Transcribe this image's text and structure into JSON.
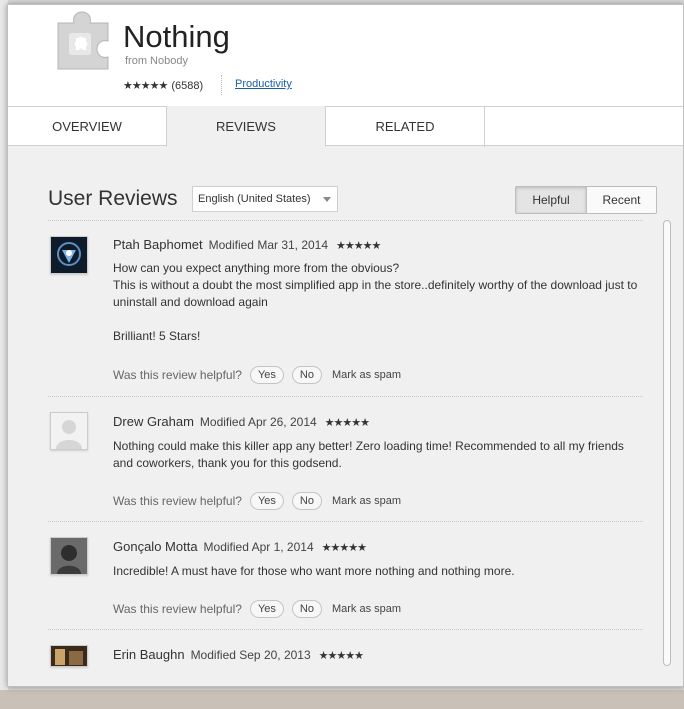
{
  "app": {
    "title": "Nothing",
    "author": "from Nobody",
    "stars": "★★★★★",
    "rating_count": "(6588)",
    "category": "Productivity"
  },
  "tabs": [
    {
      "label": "OVERVIEW",
      "active": false
    },
    {
      "label": "REVIEWS",
      "active": true
    },
    {
      "label": "RELATED",
      "active": false
    }
  ],
  "reviews_section": {
    "title": "User Reviews",
    "language": "English (United States)",
    "sort_helpful": "Helpful",
    "sort_recent": "Recent"
  },
  "reviews": [
    {
      "name": "Ptah Baphomet",
      "date": "Modified Mar 31, 2014",
      "stars": "★★★★★",
      "text": [
        "How can you expect anything more from the obvious?",
        "This is without a doubt the most simplified app in the store..definitely worthy of the download just to uninstall and download again",
        "",
        "Brilliant! 5 Stars!"
      ],
      "helpful_prompt": "Was this review helpful?",
      "yes": "Yes",
      "no": "No",
      "spam": "Mark as spam"
    },
    {
      "name": "Drew Graham",
      "date": "Modified Apr 26, 2014",
      "stars": "★★★★★",
      "text": [
        "Nothing could make this killer app any better! Zero loading time! Recommended to all my friends and coworkers, thank you for this godsend."
      ],
      "helpful_prompt": "Was this review helpful?",
      "yes": "Yes",
      "no": "No",
      "spam": "Mark as spam"
    },
    {
      "name": "Gonçalo Motta",
      "date": "Modified Apr 1, 2014",
      "stars": "★★★★★",
      "text": [
        "Incredible! A must have for those who want more nothing and nothing more."
      ],
      "helpful_prompt": "Was this review helpful?",
      "yes": "Yes",
      "no": "No",
      "spam": "Mark as spam"
    },
    {
      "name": "Erin Baughn",
      "date": "Modified Sep 20, 2013",
      "stars": "★★★★★"
    }
  ]
}
